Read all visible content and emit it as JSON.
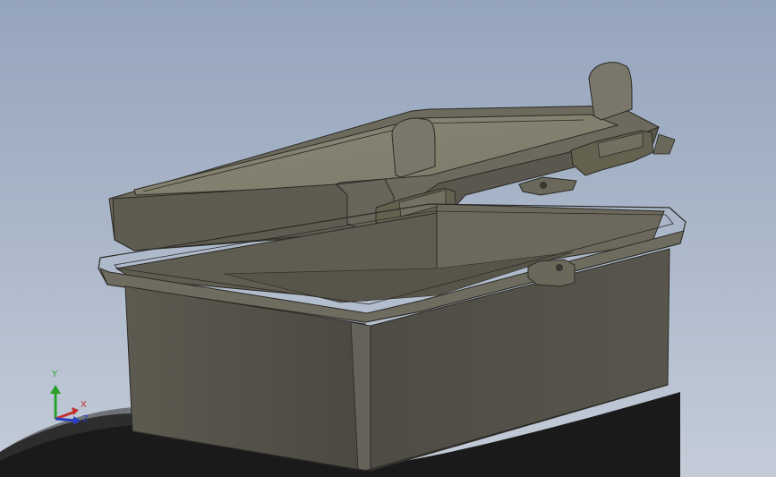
{
  "viewport": {
    "background_top": "#95a4bd",
    "background_bottom": "#c4ccd8",
    "model_color": "#6e6b5f",
    "edge_color": "#2b2a25"
  },
  "triad": {
    "y_label": "Y",
    "x_label": "X",
    "z_label": "Z",
    "y_color": "#2aa02a",
    "x_color": "#c03030",
    "z_color": "#2a3fc0"
  }
}
